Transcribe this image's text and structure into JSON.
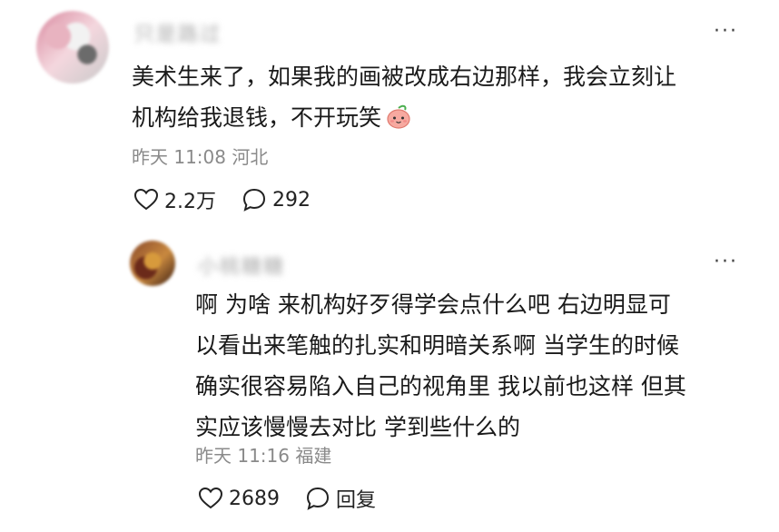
{
  "main_comment": {
    "username": "只是路过",
    "text": "美术生来了，如果我的画被改成右边那样，我会立刻让机构给我退钱，不开玩笑",
    "text_line1": "美术生来了，如果我的画被改成右边那样，我会立刻让",
    "text_line2": "机构给我退钱，不开玩笑",
    "emoji": "peach-emoji",
    "meta": "昨天 11:08 河北",
    "like_count": "2.2万",
    "reply_count": "292",
    "more_label": "···"
  },
  "reply_comment": {
    "username": "小桃糖糖",
    "text_lines": [
      "啊 为啥 来机构好歹得学会点什么吧 右边明显可",
      "以看出来笔触的扎实和明暗关系啊 当学生的时候",
      "确实很容易陷入自己的视角里 我以前也这样 但其",
      "实应该慢慢去对比 学到些什么的"
    ],
    "meta": "昨天 11:16 福建",
    "like_count": "2689",
    "reply_label": "回复",
    "more_label": "···"
  },
  "icons": {
    "like": "heart-outline-icon",
    "comment": "speech-bubble-icon",
    "more": "more-dots-icon"
  },
  "colors": {
    "text": "#1a1a1a",
    "meta": "#8a8a8a",
    "icon": "#222222"
  }
}
